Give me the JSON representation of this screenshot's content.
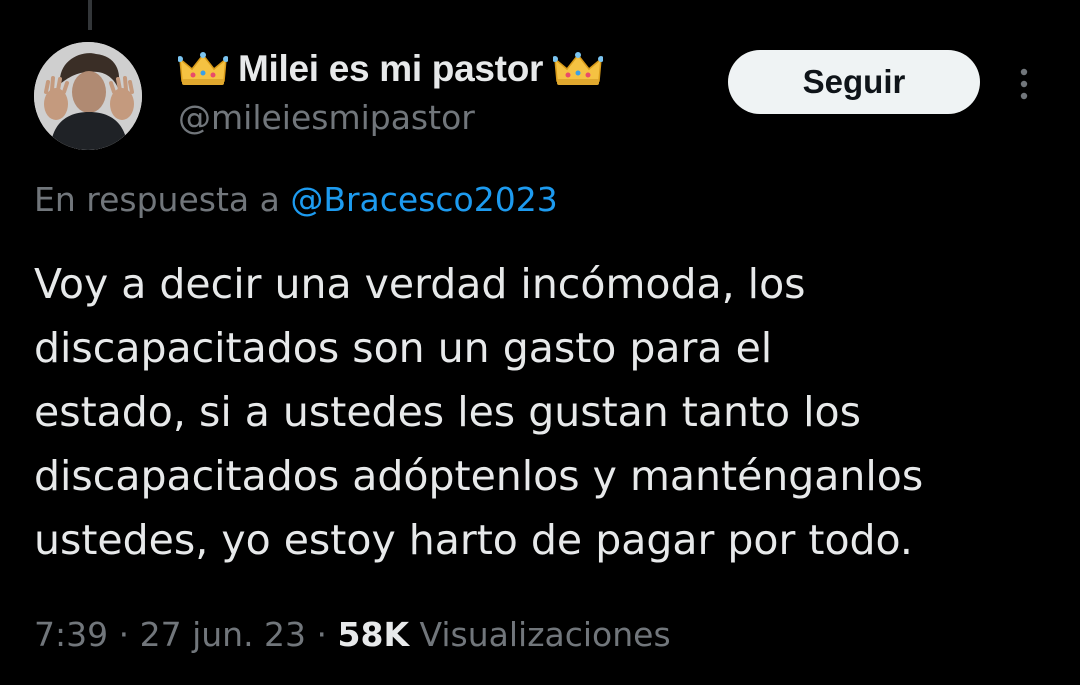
{
  "author": {
    "display_name": "Milei es mi pastor",
    "handle": "@mileiesmipastor",
    "badge_icon": "crown-emoji"
  },
  "actions": {
    "follow_label": "Seguir",
    "more_icon": "three-dots-vertical"
  },
  "reply": {
    "prefix": "En respuesta a",
    "mention": "@Bracesco2023"
  },
  "tweet": {
    "lines": [
      "Voy a decir una verdad incómoda, los",
      "discapacitados son un gasto para el",
      "estado, si a ustedes les gustan tanto los",
      "discapacitados adóptenlos y manténganlos",
      "ustedes, yo estoy harto de pagar por todo."
    ]
  },
  "meta": {
    "time": "7:39",
    "separator": "·",
    "date": "27 jun. 23",
    "views_count": "58K",
    "views_label": "Visualizaciones"
  },
  "colors": {
    "background": "#000000",
    "text_primary": "#e7e9ea",
    "text_secondary": "#71767b",
    "link": "#1d9bf0",
    "button_bg": "#eff3f4",
    "button_text": "#0f1419"
  }
}
